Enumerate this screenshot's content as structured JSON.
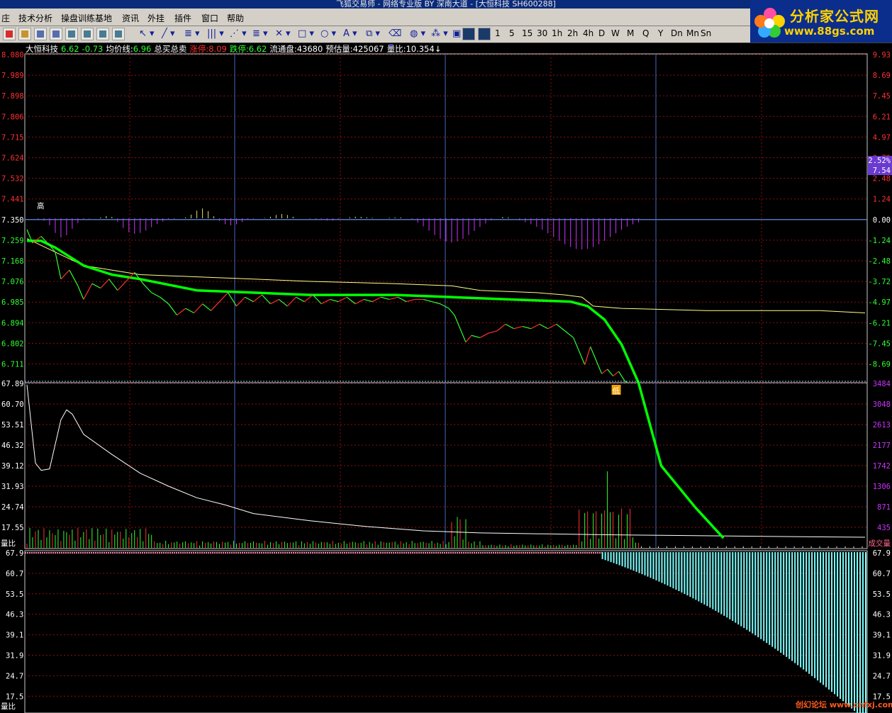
{
  "window": {
    "title": "飞狐交易师 - 网络专业版 BY 深南大道 - [大恒科技 SH600288]"
  },
  "menu": {
    "items": [
      "庄",
      "技术分析",
      "操盘训练基地",
      "资讯",
      "外挂",
      "插件",
      "窗口",
      "帮助"
    ]
  },
  "toolbar": {
    "periods": [
      "1",
      "5",
      "15",
      "30",
      "1h",
      "2h",
      "4h",
      "D",
      "W",
      "M",
      "Q",
      "Y",
      "Dn",
      "Mn",
      "Sn"
    ]
  },
  "logo": {
    "name": "分析家公式网",
    "url": "www.88gs.com"
  },
  "info": {
    "stock_name": "大恒科技",
    "price": "6.62",
    "change": "-0.73",
    "avg_label": "均价线:",
    "avg_value": "6.96",
    "total_label": "总买总卖",
    "limit_up_label": "涨停:",
    "limit_up_value": "8.09",
    "limit_down_label": "跌停:",
    "limit_down_value": "6.62",
    "float_label": "流通盘:",
    "float_value": "43680",
    "est_label": "预估量:",
    "est_value": "425067",
    "ratio_label": "量比:",
    "ratio_value": "10.354",
    "arrow": "↓"
  },
  "price_axis": {
    "left": [
      "8.080",
      "7.989",
      "7.898",
      "7.806",
      "7.715",
      "7.624",
      "7.532",
      "7.441",
      "7.350",
      "7.259",
      "7.168",
      "7.076",
      "6.985",
      "6.894",
      "6.802",
      "6.711"
    ],
    "right": [
      "9.93",
      "8.69",
      "7.45",
      "6.21",
      "4.97",
      "3.72",
      "2.48",
      "1.24",
      "0.00",
      "-1.24",
      "-2.48",
      "-3.72",
      "-4.97",
      "-6.21",
      "-7.45",
      "-8.69"
    ],
    "marker_pct": "2.52%",
    "marker_price": "7.54",
    "high_label": "高",
    "low_label": "低"
  },
  "volume_axis": {
    "left": [
      "67.89",
      "60.70",
      "53.51",
      "46.32",
      "39.12",
      "31.93",
      "24.74",
      "17.55"
    ],
    "right": [
      "3484",
      "3048",
      "2613",
      "2177",
      "1742",
      "1306",
      "871",
      "435"
    ],
    "left_label": "量比",
    "right_label": "成交量"
  },
  "bottom_axis": {
    "left": [
      "67.9",
      "60.7",
      "53.5",
      "46.3",
      "39.1",
      "31.9",
      "24.7",
      "17.5"
    ],
    "right": [
      "67.9",
      "60.7",
      "53.5",
      "46.3",
      "39.1",
      "31.9",
      "24.7",
      "17.5"
    ],
    "left_label": "量比"
  },
  "watermark": "创幻论坛 www.cnfxj.com",
  "colors": {
    "up": "#ff3030",
    "down": "#30ff30",
    "grid": "#8b1010",
    "frame": "#ffffff",
    "avg_line": "#ffff88",
    "overlay_green": "#00ff00",
    "cyan_bars": "#7fffff",
    "macd": "#cc33ff"
  },
  "chart_data": {
    "type": "line",
    "price_series": [
      [
        0,
        7.3
      ],
      [
        2,
        7.24
      ],
      [
        5,
        7.27
      ],
      [
        8,
        7.23
      ],
      [
        10,
        7.2
      ],
      [
        12,
        7.08
      ],
      [
        15,
        7.12
      ],
      [
        18,
        7.05
      ],
      [
        20,
        6.99
      ],
      [
        23,
        7.06
      ],
      [
        26,
        7.04
      ],
      [
        29,
        7.08
      ],
      [
        32,
        7.03
      ],
      [
        35,
        7.07
      ],
      [
        38,
        7.11
      ],
      [
        41,
        7.06
      ],
      [
        44,
        7.02
      ],
      [
        47,
        7.0
      ],
      [
        50,
        6.97
      ],
      [
        53,
        6.92
      ],
      [
        56,
        6.95
      ],
      [
        59,
        6.93
      ],
      [
        62,
        6.97
      ],
      [
        65,
        6.94
      ],
      [
        68,
        6.98
      ],
      [
        71,
        7.02
      ],
      [
        74,
        6.96
      ],
      [
        77,
        7.0
      ],
      [
        80,
        6.98
      ],
      [
        83,
        7.01
      ],
      [
        86,
        6.97
      ],
      [
        89,
        6.99
      ],
      [
        92,
        6.96
      ],
      [
        95,
        7.0
      ],
      [
        98,
        6.98
      ],
      [
        101,
        7.01
      ],
      [
        104,
        6.97
      ],
      [
        107,
        6.99
      ],
      [
        110,
        6.98
      ],
      [
        113,
        7.0
      ],
      [
        116,
        6.97
      ],
      [
        119,
        6.99
      ],
      [
        122,
        6.98
      ],
      [
        125,
        7.0
      ],
      [
        128,
        6.99
      ],
      [
        131,
        7.0
      ],
      [
        134,
        6.98
      ],
      [
        137,
        6.99
      ],
      [
        140,
        6.99
      ],
      [
        143,
        6.98
      ],
      [
        146,
        6.97
      ],
      [
        149,
        6.95
      ],
      [
        151,
        6.92
      ],
      [
        153,
        6.86
      ],
      [
        155,
        6.8
      ],
      [
        157,
        6.83
      ],
      [
        160,
        6.82
      ],
      [
        163,
        6.84
      ],
      [
        166,
        6.85
      ],
      [
        169,
        6.88
      ],
      [
        172,
        6.86
      ],
      [
        175,
        6.87
      ],
      [
        178,
        6.86
      ],
      [
        181,
        6.88
      ],
      [
        184,
        6.86
      ],
      [
        187,
        6.88
      ],
      [
        190,
        6.85
      ],
      [
        193,
        6.82
      ],
      [
        195,
        6.76
      ],
      [
        197,
        6.7
      ],
      [
        199,
        6.78
      ],
      [
        201,
        6.72
      ],
      [
        203,
        6.66
      ],
      [
        205,
        6.68
      ],
      [
        207,
        6.65
      ],
      [
        209,
        6.67
      ],
      [
        211,
        6.63
      ],
      [
        212,
        6.62
      ]
    ],
    "avg_series": [
      [
        0,
        7.26
      ],
      [
        10,
        7.2
      ],
      [
        20,
        7.14
      ],
      [
        30,
        7.12
      ],
      [
        40,
        7.1
      ],
      [
        60,
        7.09
      ],
      [
        80,
        7.08
      ],
      [
        100,
        7.07
      ],
      [
        130,
        7.06
      ],
      [
        150,
        7.05
      ],
      [
        160,
        7.03
      ],
      [
        180,
        7.02
      ],
      [
        190,
        7.01
      ],
      [
        196,
        7.0
      ],
      [
        200,
        6.96
      ],
      [
        210,
        6.95
      ],
      [
        240,
        6.94
      ],
      [
        280,
        6.94
      ],
      [
        296,
        6.93
      ]
    ],
    "overlay_series": [
      [
        0,
        7.25
      ],
      [
        5,
        7.25
      ],
      [
        10,
        7.22
      ],
      [
        20,
        7.14
      ],
      [
        30,
        7.1
      ],
      [
        40,
        7.08
      ],
      [
        60,
        7.03
      ],
      [
        80,
        7.02
      ],
      [
        100,
        7.01
      ],
      [
        130,
        7.01
      ],
      [
        150,
        7.0
      ],
      [
        170,
        6.99
      ],
      [
        192,
        6.98
      ],
      [
        198,
        6.96
      ],
      [
        204,
        6.9
      ],
      [
        210,
        6.79
      ],
      [
        216,
        6.62
      ]
    ],
    "volume_ratio_series": [
      [
        0,
        67.2
      ],
      [
        3,
        40.0
      ],
      [
        5,
        37.5
      ],
      [
        8,
        38.0
      ],
      [
        12,
        55.0
      ],
      [
        14,
        58.5
      ],
      [
        16,
        57.0
      ],
      [
        20,
        50.0
      ],
      [
        30,
        43.0
      ],
      [
        40,
        36.5
      ],
      [
        50,
        32.0
      ],
      [
        60,
        28.0
      ],
      [
        70,
        25.5
      ],
      [
        80,
        22.5
      ],
      [
        100,
        20.0
      ],
      [
        120,
        18.0
      ],
      [
        140,
        16.5
      ],
      [
        160,
        15.8
      ],
      [
        180,
        15.5
      ],
      [
        200,
        15.2
      ],
      [
        230,
        14.9
      ],
      [
        260,
        14.6
      ],
      [
        296,
        14.3
      ]
    ],
    "overlay_volume_series": [
      [
        216,
        67.89
      ],
      [
        224,
        39.1
      ],
      [
        236,
        24.7
      ],
      [
        246,
        14.0
      ]
    ],
    "x_range": [
      0,
      296
    ],
    "price_range": [
      6.62,
      8.08
    ],
    "prev_close": 7.35,
    "volume_ratio_range": [
      10.36,
      67.89
    ],
    "bottom_range": [
      10.3,
      67.9
    ],
    "bottom_bars_start": 203,
    "bottom_bars_end_value": 10.5,
    "grid": true
  }
}
